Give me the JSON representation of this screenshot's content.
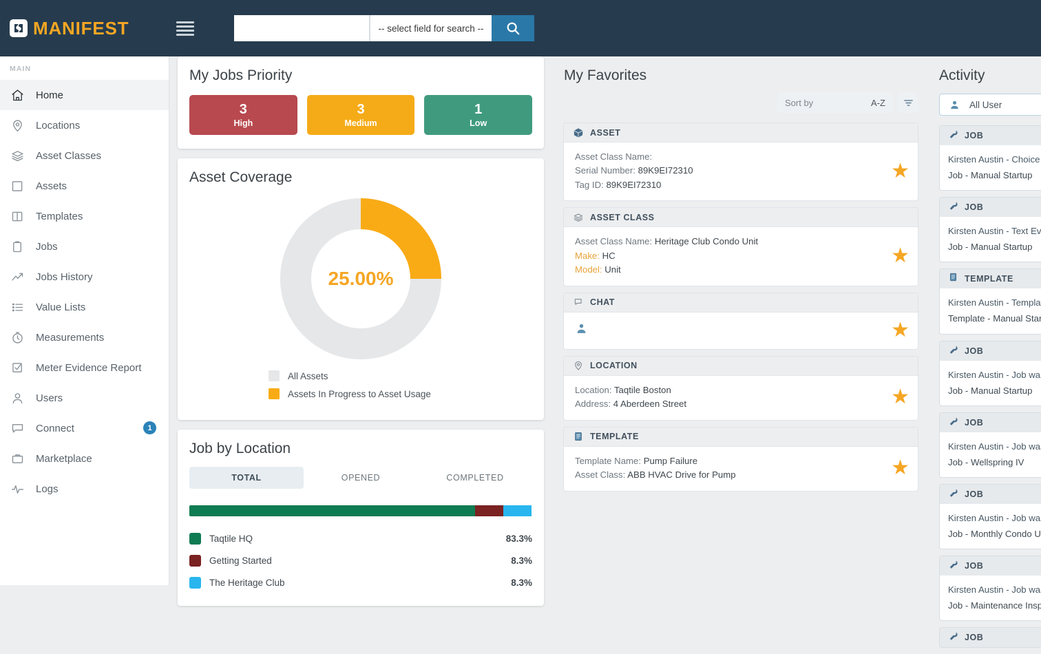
{
  "header": {
    "brand": "MANIFEST",
    "menu_icon": "hamburger-icon",
    "search_value": "",
    "search_placeholder": "",
    "field_select": "-- select field for search --",
    "search_icon": "search-icon",
    "bg_color": "#263c4e",
    "accent_color": "#f5a623",
    "search_button_color": "#2a78a8"
  },
  "sidebar": {
    "section_label": "MAIN",
    "items": [
      {
        "label": "Home",
        "icon": "home-icon",
        "active": true,
        "badge": ""
      },
      {
        "label": "Locations",
        "icon": "pin-icon",
        "active": false,
        "badge": ""
      },
      {
        "label": "Asset Classes",
        "icon": "layers-icon",
        "active": false,
        "badge": ""
      },
      {
        "label": "Assets",
        "icon": "box-icon",
        "active": false,
        "badge": ""
      },
      {
        "label": "Templates",
        "icon": "book-icon",
        "active": false,
        "badge": ""
      },
      {
        "label": "Jobs",
        "icon": "clipboard-icon",
        "active": false,
        "badge": ""
      },
      {
        "label": "Jobs History",
        "icon": "trend-up-icon",
        "active": false,
        "badge": ""
      },
      {
        "label": "Value Lists",
        "icon": "list-icon",
        "active": false,
        "badge": ""
      },
      {
        "label": "Measurements",
        "icon": "stopwatch-icon",
        "active": false,
        "badge": ""
      },
      {
        "label": "Meter Evidence Report",
        "icon": "check-square-icon",
        "active": false,
        "badge": ""
      },
      {
        "label": "Users",
        "icon": "user-icon",
        "active": false,
        "badge": ""
      },
      {
        "label": "Connect",
        "icon": "chat-icon",
        "active": false,
        "badge": "1"
      },
      {
        "label": "Marketplace",
        "icon": "briefcase-icon",
        "active": false,
        "badge": ""
      },
      {
        "label": "Logs",
        "icon": "pulse-icon",
        "active": false,
        "badge": ""
      }
    ]
  },
  "jobs_priority": {
    "title": "My Jobs Priority",
    "tiles": [
      {
        "count": "3",
        "label": "High",
        "color": "#b8494f"
      },
      {
        "count": "3",
        "label": "Medium",
        "color": "#f5ab17"
      },
      {
        "count": "1",
        "label": "Low",
        "color": "#409b7e"
      }
    ]
  },
  "asset_coverage": {
    "title": "Asset Coverage",
    "center_label": "25.00%",
    "legend": [
      {
        "label": "All Assets",
        "color": "#e6e7e8"
      },
      {
        "label": "Assets In Progress to Asset Usage",
        "color": "#f9ab16"
      }
    ]
  },
  "job_by_location": {
    "title": "Job by Location",
    "tabs": [
      {
        "label": "TOTAL",
        "active": true
      },
      {
        "label": "OPENED",
        "active": false
      },
      {
        "label": "COMPLETED",
        "active": false
      }
    ],
    "rows": [
      {
        "name": "Taqtile HQ",
        "percent": "83.3%",
        "color": "#0f7b52"
      },
      {
        "name": "Getting Started",
        "percent": "8.3%",
        "color": "#7b2222"
      },
      {
        "name": "The Heritage Club",
        "percent": "8.3%",
        "color": "#29b6ee"
      }
    ]
  },
  "favorites": {
    "title": "My Favorites",
    "sort_label": "Sort by",
    "sort_value": "A-Z",
    "filter_icon": "filter-icon",
    "cards": [
      {
        "type": "ASSET",
        "icon": "cube-icon",
        "starred": true,
        "lines": [
          {
            "key": "Asset Class Name:",
            "value": "",
            "amber": false
          },
          {
            "key": "Serial Number:",
            "value": "89K9EI72310",
            "amber": false
          },
          {
            "key": "Tag ID:",
            "value": "89K9EI72310",
            "amber": false
          }
        ]
      },
      {
        "type": "ASSET CLASS",
        "icon": "layers-icon",
        "starred": true,
        "lines": [
          {
            "key": "Asset Class Name:",
            "value": "Heritage Club Condo Unit",
            "amber": false
          },
          {
            "key": "Make:",
            "value": "HC",
            "amber": true
          },
          {
            "key": "Model:",
            "value": "Unit",
            "amber": true
          }
        ]
      },
      {
        "type": "CHAT",
        "icon": "chat-bubble-icon",
        "starred": true,
        "lines": [],
        "avatar_icon": "user-avatar-icon"
      },
      {
        "type": "LOCATION",
        "icon": "pin-icon",
        "starred": true,
        "lines": [
          {
            "key": "Location:",
            "value": "Taqtile Boston",
            "amber": false
          },
          {
            "key": "Address:",
            "value": "4 Aberdeen Street",
            "amber": false
          }
        ]
      },
      {
        "type": "TEMPLATE",
        "icon": "document-icon",
        "starred": true,
        "lines": [
          {
            "key": "Template Name:",
            "value": "Pump Failure",
            "amber": false
          },
          {
            "key": "Asset Class:",
            "value": "ABB HVAC Drive for Pump",
            "amber": false
          }
        ]
      }
    ]
  },
  "activity": {
    "title": "Activity",
    "user_filter": "All User",
    "user_filter_icon": "user-avatar-icon",
    "cards": [
      {
        "type": "JOB",
        "icon": "wrench-icon",
        "line1": "Kirsten Austin - Choice E",
        "line2": "Job - Manual Startup"
      },
      {
        "type": "JOB",
        "icon": "wrench-icon",
        "line1": "Kirsten Austin - Text Evid",
        "line2": "Job - Manual Startup"
      },
      {
        "type": "TEMPLATE",
        "icon": "document-icon",
        "line1": "Kirsten Austin - Template",
        "line2": "Template - Manual Startu"
      },
      {
        "type": "JOB",
        "icon": "wrench-icon",
        "line1": "Kirsten Austin - Job was",
        "line2": "Job - Manual Startup"
      },
      {
        "type": "JOB",
        "icon": "wrench-icon",
        "line1": "Kirsten Austin - Job was",
        "line2": "Job - Wellspring IV"
      },
      {
        "type": "JOB",
        "icon": "wrench-icon",
        "line1": "Kirsten Austin - Job was",
        "line2": "Job - Monthly Condo Uni"
      },
      {
        "type": "JOB",
        "icon": "wrench-icon",
        "line1": "Kirsten Austin - Job was",
        "line2": "Job - Maintenance Inspe"
      },
      {
        "type": "JOB",
        "icon": "wrench-icon",
        "line1": "",
        "line2": ""
      }
    ]
  },
  "chart_data": [
    {
      "type": "pie",
      "title": "Asset Coverage",
      "labels": [
        "All Assets",
        "Assets In Progress to Asset Usage"
      ],
      "values": [
        75.0,
        25.0
      ],
      "colors": [
        "#e6e7e8",
        "#f9ab16"
      ],
      "center_label": "25.00%",
      "legend": "bottom",
      "donut": true
    },
    {
      "type": "bar",
      "title": "Job by Location",
      "subtitle": "TOTAL",
      "categories": [
        "Taqtile HQ",
        "Getting Started",
        "The Heritage Club"
      ],
      "values": [
        83.3,
        8.3,
        8.3
      ],
      "colors": [
        "#0f7b52",
        "#7b2222",
        "#29b6ee"
      ],
      "xlabel": "",
      "ylabel": "",
      "ylim": [
        0,
        100
      ],
      "stacked": true,
      "orientation": "horizontal",
      "grid": false,
      "legend": "bottom"
    },
    {
      "type": "bar",
      "title": "My Jobs Priority",
      "categories": [
        "High",
        "Medium",
        "Low"
      ],
      "values": [
        3,
        3,
        1
      ],
      "colors": [
        "#b8494f",
        "#f5ab17",
        "#409b7e"
      ],
      "xlabel": "",
      "ylabel": "",
      "grid": false,
      "legend": "none"
    }
  ]
}
